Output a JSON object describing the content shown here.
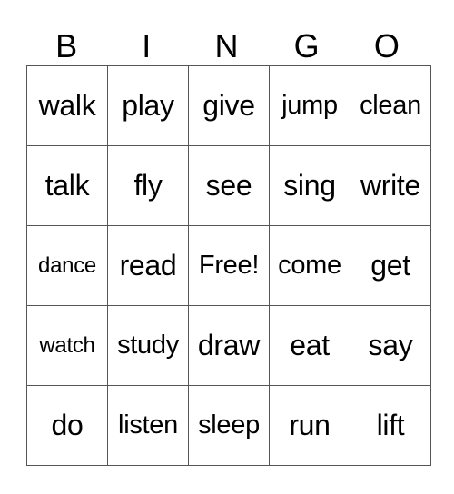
{
  "header": [
    "B",
    "I",
    "N",
    "G",
    "O"
  ],
  "rows": [
    [
      "walk",
      "play",
      "give",
      "jump",
      "clean"
    ],
    [
      "talk",
      "fly",
      "see",
      "sing",
      "write"
    ],
    [
      "dance",
      "read",
      "Free!",
      "come",
      "get"
    ],
    [
      "watch",
      "study",
      "draw",
      "eat",
      "say"
    ],
    [
      "do",
      "listen",
      "sleep",
      "run",
      "lift"
    ]
  ]
}
